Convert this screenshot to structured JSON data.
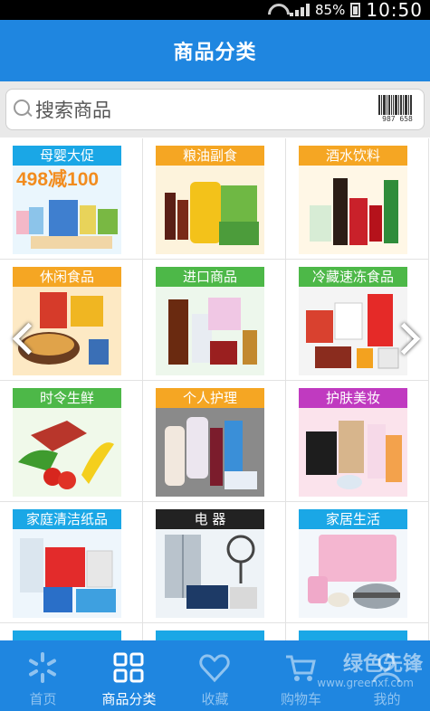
{
  "status_bar": {
    "battery": "85%",
    "time": "10:50"
  },
  "header": {
    "title": "商品分类"
  },
  "search": {
    "placeholder": "搜索商品",
    "barcode_number": "987 658"
  },
  "categories": [
    {
      "label": "母婴大促",
      "label_color": "#1aa7e6",
      "promo": "498减100"
    },
    {
      "label": "粮油副食",
      "label_color": "#f5a623"
    },
    {
      "label": "酒水饮料",
      "label_color": "#f5a623"
    },
    {
      "label": "休闲食品",
      "label_color": "#f5a623"
    },
    {
      "label": "进口商品",
      "label_color": "#4db848"
    },
    {
      "label": "冷藏速冻食品",
      "label_color": "#4db848"
    },
    {
      "label": "时令生鲜",
      "label_color": "#4db848"
    },
    {
      "label": "个人护理",
      "label_color": "#f5a623"
    },
    {
      "label": "护肤美妆",
      "label_color": "#c03ac0"
    },
    {
      "label": "家庭清洁纸品",
      "label_color": "#1aa7e6"
    },
    {
      "label": "电 器",
      "label_color": "#222222"
    },
    {
      "label": "家居生活",
      "label_color": "#1aa7e6"
    },
    {
      "label": "",
      "label_color": "#1aa7e6"
    },
    {
      "label": "",
      "label_color": "#1aa7e6"
    },
    {
      "label": "",
      "label_color": "#1aa7e6"
    }
  ],
  "bottom_nav": [
    {
      "label": "首页",
      "icon": "walmart-spark-icon"
    },
    {
      "label": "商品分类",
      "icon": "grid-icon"
    },
    {
      "label": "收藏",
      "icon": "heart-icon"
    },
    {
      "label": "购物车",
      "icon": "cart-icon"
    },
    {
      "label": "我的",
      "icon": "user-icon"
    }
  ],
  "watermark": {
    "text": "绿色先锋",
    "url": "www.greenxf.com"
  },
  "colors": {
    "brand": "#1f86e0",
    "status_bar": "#000000"
  }
}
